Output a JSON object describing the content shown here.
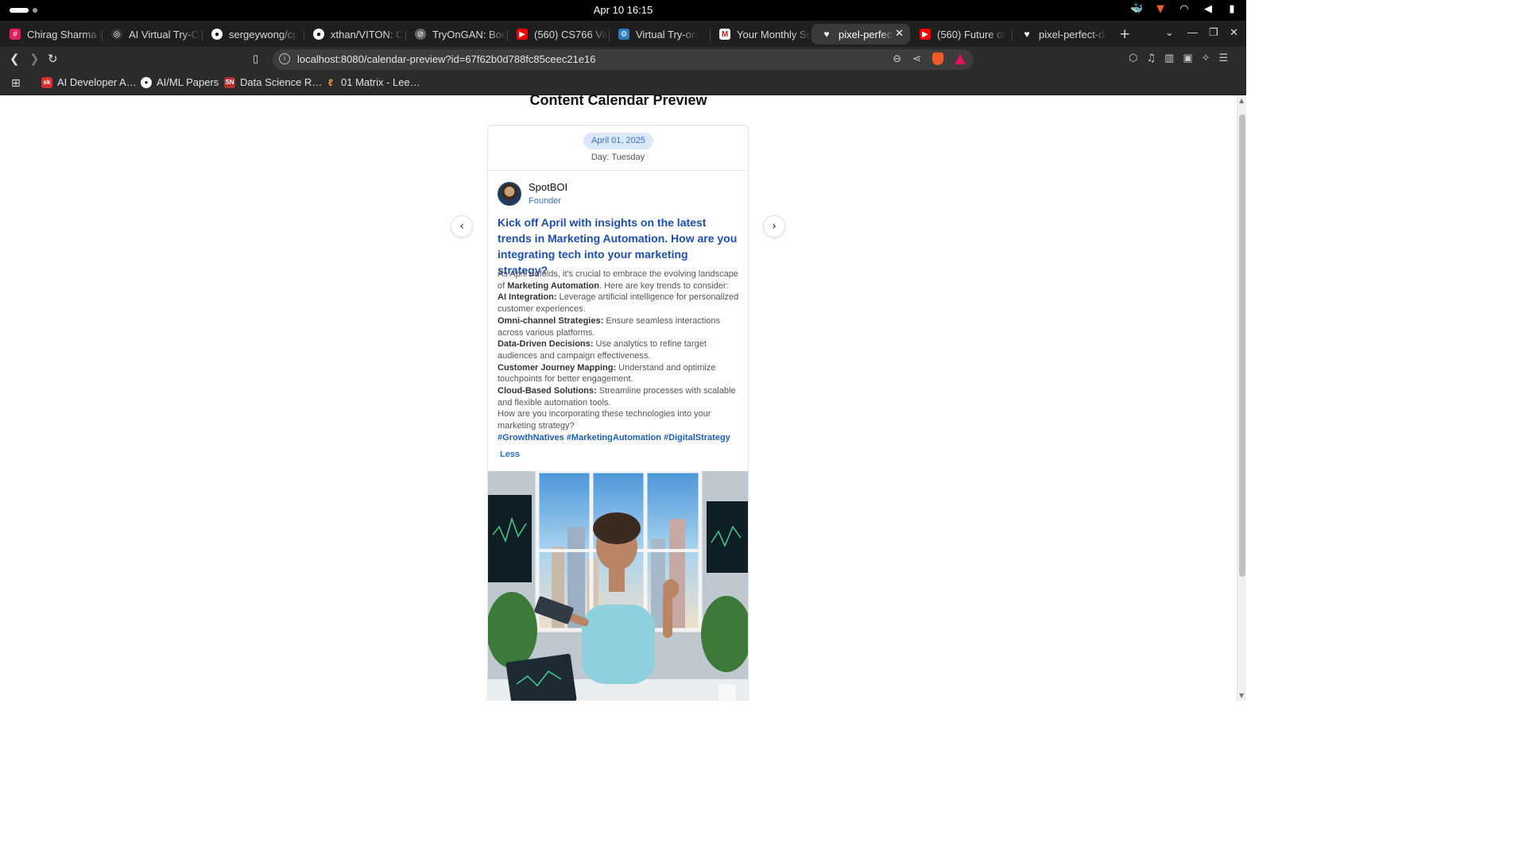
{
  "os": {
    "clock": "Apr 10  16:15"
  },
  "tabs": [
    {
      "title": "Chirag Sharma (",
      "icon": "slack-icon",
      "color": "#e01e5a"
    },
    {
      "title": "AI Virtual Try-O",
      "icon": "openai-icon",
      "color": "#444444"
    },
    {
      "title": "sergeywong/cp",
      "icon": "github-icon",
      "color": "#333333"
    },
    {
      "title": "xthan/VITON: C",
      "icon": "github-icon",
      "color": "#333333"
    },
    {
      "title": "TryOnGAN: Bod",
      "icon": "globe-icon",
      "color": "#555555"
    },
    {
      "title": "(560) CS766 Vir",
      "icon": "youtube-icon",
      "color": "#ff0000"
    },
    {
      "title": "Virtual Try-on",
      "icon": "site-icon",
      "color": "#2f7bbf"
    },
    {
      "title": "Your Monthly Sc",
      "icon": "gmail-icon",
      "color": "#c5221f"
    },
    {
      "title": "pixel-perfec",
      "icon": "heart-icon",
      "color": "#ffffff",
      "active": true
    },
    {
      "title": "(560) Future of",
      "icon": "youtube-icon",
      "color": "#ff0000"
    },
    {
      "title": "pixel-perfect-di",
      "icon": "heart-icon",
      "color": "#ffffff"
    }
  ],
  "toolbar": {
    "url": "localhost:8080/calendar-preview?id=67f62b0d788fc85ceec21e16"
  },
  "bookmarks": [
    {
      "label": "AI Developer A…",
      "icon": "sk-icon",
      "color": "#d6312e"
    },
    {
      "label": "AI/ML Papers",
      "icon": "github-icon",
      "color": "#333333"
    },
    {
      "label": "Data Science R…",
      "icon": "sn-icon",
      "color": "#b03030"
    },
    {
      "label": "01 Matrix - Lee…",
      "icon": "leetcode-icon",
      "color": "#f5a623"
    }
  ],
  "page": {
    "title": "Content Calendar Preview",
    "date": "April 01, 2025",
    "day": "Day: Tuesday",
    "author": {
      "name": "SpotBOI",
      "role": "Founder"
    },
    "headline": "Kick off April with insights on the latest trends in Marketing Automation. How are you integrating tech into your marketing strategy?",
    "intro_a": "As April unfolds, it's crucial to embrace the evolving landscape of ",
    "intro_b": "Marketing Automation",
    "intro_c": ". Here are key trends to consider:",
    "trends": [
      {
        "term": "AI Integration:",
        "desc": " Leverage artificial intelligence for personalized customer experiences."
      },
      {
        "term": "Omni-channel Strategies:",
        "desc": " Ensure seamless interactions across various platforms."
      },
      {
        "term": "Data-Driven Decisions:",
        "desc": " Use analytics to refine target audiences and campaign effectiveness."
      },
      {
        "term": "Customer Journey Mapping:",
        "desc": " Understand and optimize touchpoints for better engagement."
      },
      {
        "term": "Cloud-Based Solutions:",
        "desc": " Streamline processes with scalable and flexible automation tools."
      }
    ],
    "closing": "How are you incorporating these technologies into your marketing strategy?",
    "hashtags": "#GrowthNatives #MarketingAutomation #DigitalStrategy",
    "less_label": "Less"
  }
}
